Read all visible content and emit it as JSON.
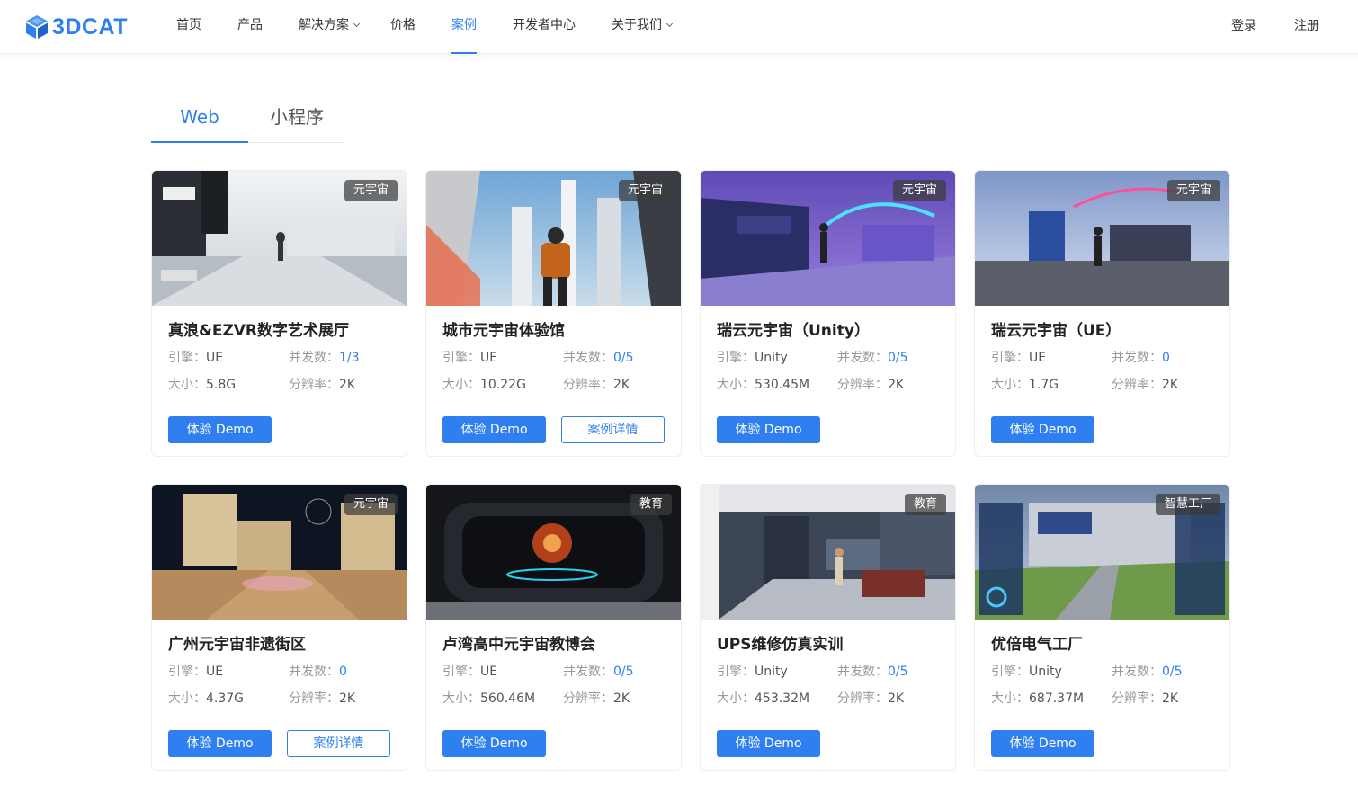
{
  "brand": {
    "name": "3DCAT",
    "accent": "#2f7ff0"
  },
  "nav": {
    "items": [
      {
        "label": "首页",
        "dropdown": false,
        "active": false
      },
      {
        "label": "产品",
        "dropdown": false,
        "active": false
      },
      {
        "label": "解决方案",
        "dropdown": true,
        "active": false
      },
      {
        "label": "价格",
        "dropdown": false,
        "active": false
      },
      {
        "label": "案例",
        "dropdown": false,
        "active": true
      },
      {
        "label": "开发者中心",
        "dropdown": false,
        "active": false
      },
      {
        "label": "关于我们",
        "dropdown": true,
        "active": false
      }
    ],
    "login": "登录",
    "register": "注册"
  },
  "tabs": [
    {
      "label": "Web",
      "active": true
    },
    {
      "label": "小程序",
      "active": false
    }
  ],
  "labels": {
    "engine": "引擎：",
    "concurrency": "并发数：",
    "size": "大小：",
    "resolution": "分辨率：",
    "demo_button": "体验 Demo",
    "detail_button": "案例详情"
  },
  "cards": [
    {
      "title": "真浪&EZVR数字艺术展厅",
      "badge": "元宇宙",
      "engine": "UE",
      "concurrency": "1/3",
      "size": "5.8G",
      "resolution": "2K",
      "has_detail": false
    },
    {
      "title": "城市元宇宙体验馆",
      "badge": "元宇宙",
      "engine": "UE",
      "concurrency": "0/5",
      "size": "10.22G",
      "resolution": "2K",
      "has_detail": true
    },
    {
      "title": "瑞云元宇宙（Unity）",
      "badge": "元宇宙",
      "engine": "Unity",
      "concurrency": "0/5",
      "size": "530.45M",
      "resolution": "2K",
      "has_detail": false
    },
    {
      "title": "瑞云元宇宙（UE）",
      "badge": "元宇宙",
      "engine": "UE",
      "concurrency": "0",
      "size": "1.7G",
      "resolution": "2K",
      "has_detail": false
    },
    {
      "title": "广州元宇宙非遗街区",
      "badge": "元宇宙",
      "engine": "UE",
      "concurrency": "0",
      "size": "4.37G",
      "resolution": "2K",
      "has_detail": true
    },
    {
      "title": "卢湾高中元宇宙教博会",
      "badge": "教育",
      "engine": "UE",
      "concurrency": "0/5",
      "size": "560.46M",
      "resolution": "2K",
      "has_detail": false
    },
    {
      "title": "UPS维修仿真实训",
      "badge": "教育",
      "engine": "Unity",
      "concurrency": "0/5",
      "size": "453.32M",
      "resolution": "2K",
      "has_detail": false
    },
    {
      "title": "优倍电气工厂",
      "badge": "智慧工厂",
      "engine": "Unity",
      "concurrency": "0/5",
      "size": "687.37M",
      "resolution": "2K",
      "has_detail": false
    }
  ]
}
